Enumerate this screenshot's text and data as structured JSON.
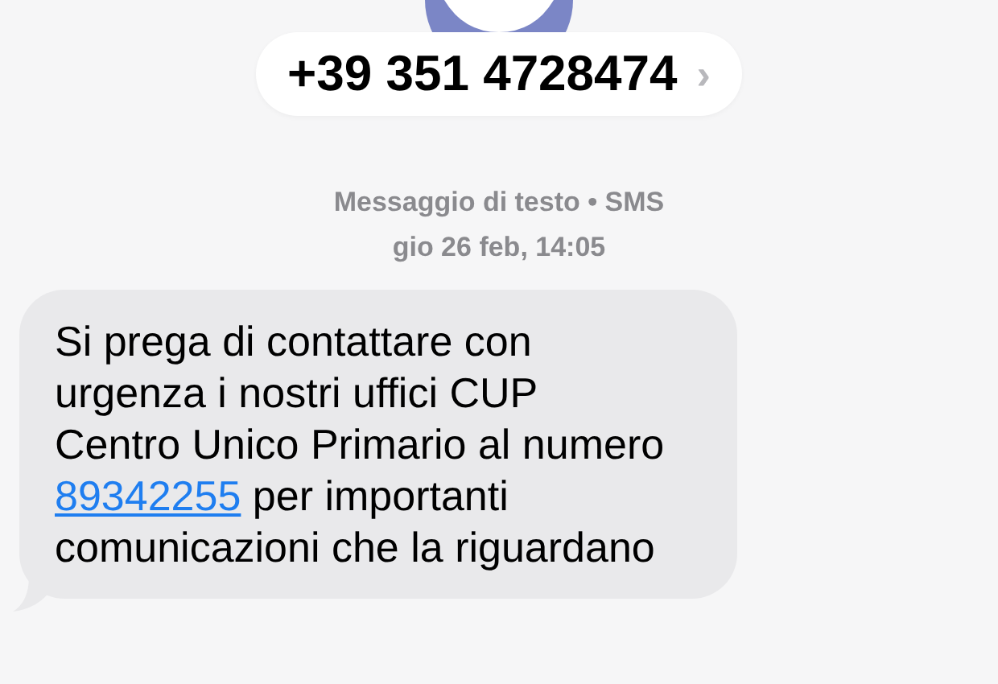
{
  "contact": {
    "name": "+39 351 4728474",
    "chevron": "›"
  },
  "header": {
    "service": "Messaggio di testo • SMS",
    "timestamp": "gio 26 feb, 14:05"
  },
  "messages": [
    {
      "kind": "incoming",
      "text_before": "Si prega di contattare con urgenza i nostri uffici CUP Centro Unico Primario al numero ",
      "link": "89342255",
      "text_after": " per importanti comunicazioni che la riguardano"
    }
  ]
}
